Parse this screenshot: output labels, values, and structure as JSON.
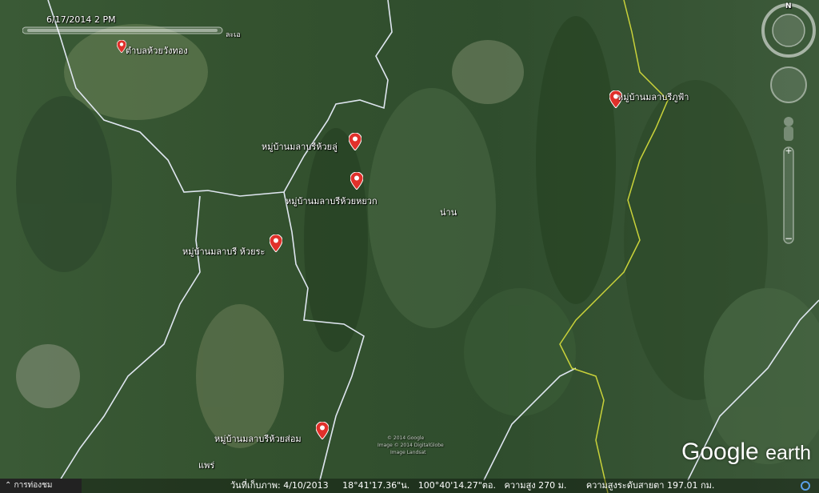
{
  "time_slider": {
    "date": "6/17/2014",
    "time": "2 PM",
    "ratio_label": "ละเอ"
  },
  "places": [
    {
      "label": "ตำบลห้วยวังทอง"
    },
    {
      "label": "หมู่บ้านมลาบรีห้วยลู่"
    },
    {
      "label": "หมู่บ้านมลาบรีห้วยหยวก"
    },
    {
      "label": "หมู่บ้านมลาบรี ห้วยระ"
    },
    {
      "label": "หมู่บ้านมลาบรีภูฟ้า"
    },
    {
      "label": "หมู่บ้านมลาบรีห้วยส่อม"
    }
  ],
  "region_labels": {
    "nan": "น่าน",
    "phrae": "แพร่"
  },
  "copyright": {
    "line1": "© 2014 Google",
    "line2": "Image © 2014 DigitalGlobe",
    "line3": "Image Landsat"
  },
  "logo": {
    "google": "Google",
    "earth": "earth"
  },
  "tour_guide": {
    "label": "⌃ การท่องชม"
  },
  "status_bar": {
    "imagery_date": "วันที่เก็บภาพ: 4/10/2013",
    "latitude": "18°41'17.36\"น.",
    "longitude": "100°40'14.27\"ตอ.",
    "elevation": "ความสูง   270 ม.",
    "eye_altitude": "ความสูงระดับสายตา 197.01 กม."
  },
  "compass": {
    "north": "N"
  },
  "colors": {
    "border_province": "#dfe6f0",
    "border_national": "#c9d23a",
    "pin": "#e0302a"
  }
}
